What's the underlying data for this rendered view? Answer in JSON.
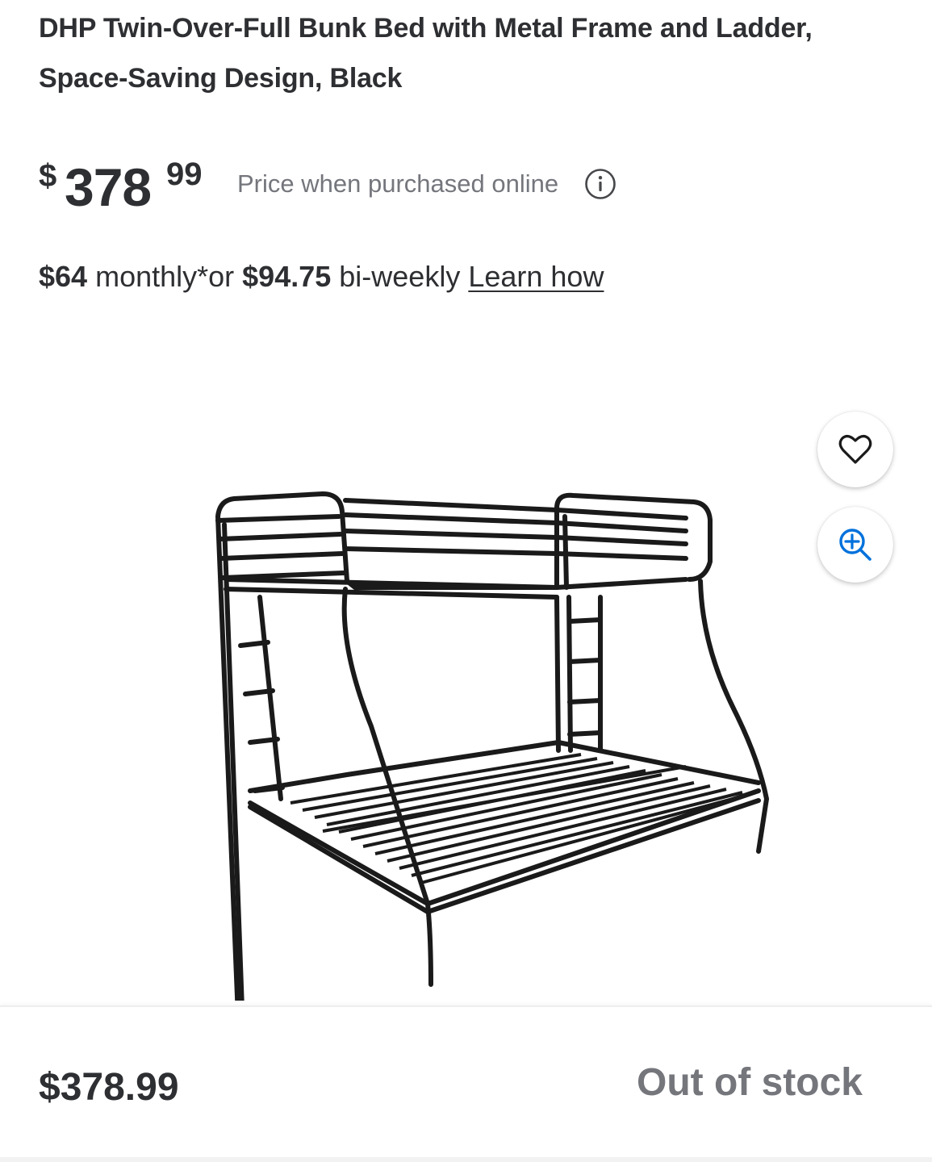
{
  "product": {
    "title": "DHP Twin-Over-Full Bunk Bed with Metal Frame and Ladder, Space-Saving Design, Black"
  },
  "price": {
    "currency_symbol": "$",
    "dollars": "378",
    "cents": "99",
    "note": "Price when purchased online",
    "info_icon": "info-icon"
  },
  "financing": {
    "monthly_amount": "$64",
    "monthly_text": " monthly*or ",
    "biweekly_amount": "$94.75",
    "biweekly_text": " bi-weekly ",
    "learn_link": "Learn how"
  },
  "image": {
    "description_icon": "bunk-bed-image"
  },
  "actions": {
    "favorite_icon": "heart-icon",
    "zoom_icon": "zoom-in-icon",
    "accent_color": "#0071dc"
  },
  "bottom_bar": {
    "price": "$378.99",
    "status": "Out of stock"
  }
}
